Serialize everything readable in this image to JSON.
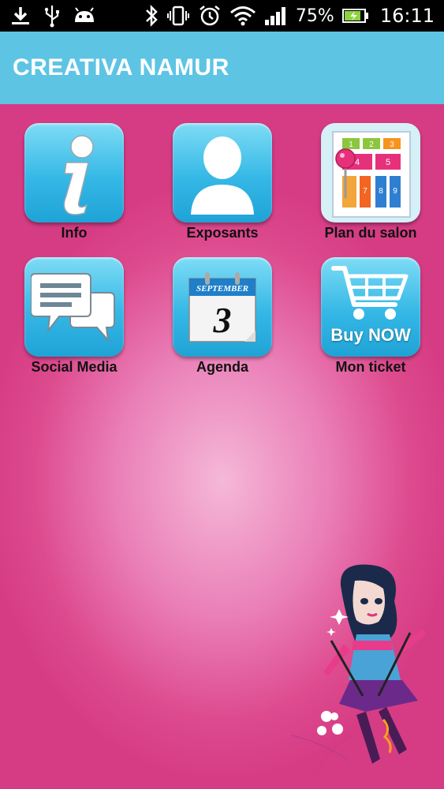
{
  "status_bar": {
    "icons_left": [
      "download-icon",
      "usb-icon",
      "android-icon"
    ],
    "icons_right": [
      "bluetooth-icon",
      "vibrate-icon",
      "alarm-icon",
      "wifi-icon",
      "signal-icon",
      "battery-icon"
    ],
    "battery_percent": "75%",
    "time": "16:11"
  },
  "app_bar": {
    "title": "CREATIVA NAMUR",
    "color": "#5ec4e4"
  },
  "colors": {
    "background_pink": "#dd4a8e",
    "tile_blue": "#35b8e6"
  },
  "tiles": [
    {
      "label": "Info",
      "icon": "info-icon"
    },
    {
      "label": "Exposants",
      "icon": "person-icon"
    },
    {
      "label": "Plan du salon",
      "icon": "floor-plan-icon"
    },
    {
      "label": "Social Media",
      "icon": "chat-bubbles-icon"
    },
    {
      "label": "Agenda",
      "icon": "calendar-icon"
    },
    {
      "label": "Mon ticket",
      "icon": "shopping-cart-icon"
    }
  ],
  "icon_text": {
    "calendar_month": "SEPTEMBER",
    "calendar_day": "3",
    "buy_now": "Buy NOW",
    "plan_numbers": [
      "1",
      "2",
      "3",
      "4",
      "5",
      "7",
      "8",
      "9"
    ]
  }
}
